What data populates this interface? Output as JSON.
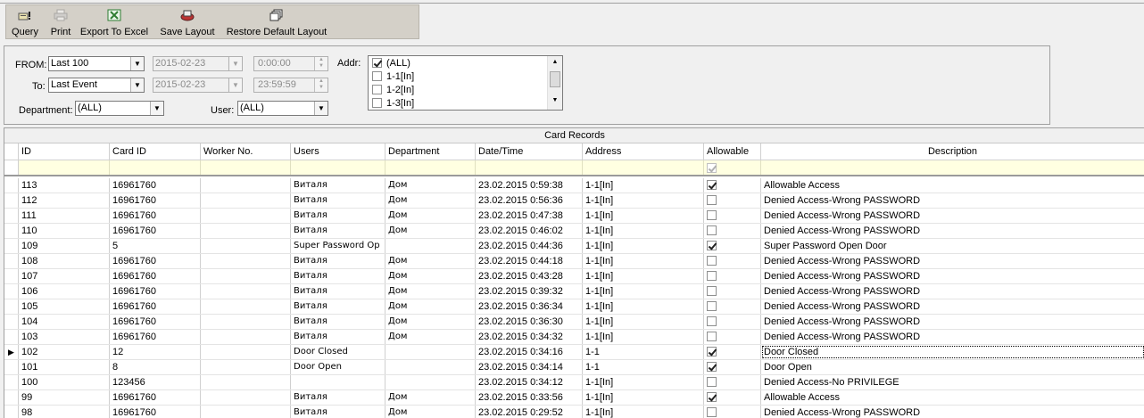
{
  "toolbar": {
    "query": {
      "label": "Query",
      "icon": "query-icon"
    },
    "print": {
      "label": "Print",
      "icon": "print-icon"
    },
    "export": {
      "label": "Export To Excel",
      "icon": "excel-icon"
    },
    "save": {
      "label": "Save Layout",
      "icon": "save-layout-icon"
    },
    "restore": {
      "label": "Restore Default Layout",
      "icon": "restore-layout-icon"
    }
  },
  "filters": {
    "from_label": "FROM:",
    "from_value": "Last 100",
    "from_date": "2015-02-23",
    "from_time": "0:00:00",
    "to_label": "To:",
    "to_value": "Last Event",
    "to_date": "2015-02-23",
    "to_time": "23:59:59",
    "addr_label": "Addr:",
    "addr_items": [
      {
        "label": "(ALL)",
        "checked": true
      },
      {
        "label": "1-1[In]",
        "checked": false
      },
      {
        "label": "1-2[In]",
        "checked": false
      },
      {
        "label": "1-3[In]",
        "checked": false
      }
    ],
    "department_label": "Department:",
    "department_value": "(ALL)",
    "user_label": "User:",
    "user_value": "(ALL)"
  },
  "grid": {
    "title": "Card Records",
    "columns": [
      "ID",
      "Card ID",
      "Worker No.",
      "Users",
      "Department",
      "Date/Time",
      "Address",
      "Allowable",
      "Description"
    ],
    "filter_allowable_checked": true,
    "current_row_index": 11,
    "rows": [
      {
        "id": "113",
        "card": "16961760",
        "worker": "",
        "user": "Виталя",
        "dept": "Дом",
        "dt": "23.02.2015 0:59:38",
        "addr": "1-1[In]",
        "allow": true,
        "desc": "Allowable Access"
      },
      {
        "id": "112",
        "card": "16961760",
        "worker": "",
        "user": "Виталя",
        "dept": "Дом",
        "dt": "23.02.2015 0:56:36",
        "addr": "1-1[In]",
        "allow": false,
        "desc": "Denied Access-Wrong PASSWORD"
      },
      {
        "id": "111",
        "card": "16961760",
        "worker": "",
        "user": "Виталя",
        "dept": "Дом",
        "dt": "23.02.2015 0:47:38",
        "addr": "1-1[In]",
        "allow": false,
        "desc": "Denied Access-Wrong PASSWORD"
      },
      {
        "id": "110",
        "card": "16961760",
        "worker": "",
        "user": "Виталя",
        "dept": "Дом",
        "dt": "23.02.2015 0:46:02",
        "addr": "1-1[In]",
        "allow": false,
        "desc": "Denied Access-Wrong PASSWORD"
      },
      {
        "id": "109",
        "card": "5",
        "worker": "",
        "user": "Super Password Op",
        "dept": "",
        "dt": "23.02.2015 0:44:36",
        "addr": "1-1[In]",
        "allow": true,
        "desc": "Super Password Open Door"
      },
      {
        "id": "108",
        "card": "16961760",
        "worker": "",
        "user": "Виталя",
        "dept": "Дом",
        "dt": "23.02.2015 0:44:18",
        "addr": "1-1[In]",
        "allow": false,
        "desc": "Denied Access-Wrong PASSWORD"
      },
      {
        "id": "107",
        "card": "16961760",
        "worker": "",
        "user": "Виталя",
        "dept": "Дом",
        "dt": "23.02.2015 0:43:28",
        "addr": "1-1[In]",
        "allow": false,
        "desc": "Denied Access-Wrong PASSWORD"
      },
      {
        "id": "106",
        "card": "16961760",
        "worker": "",
        "user": "Виталя",
        "dept": "Дом",
        "dt": "23.02.2015 0:39:32",
        "addr": "1-1[In]",
        "allow": false,
        "desc": "Denied Access-Wrong PASSWORD"
      },
      {
        "id": "105",
        "card": "16961760",
        "worker": "",
        "user": "Виталя",
        "dept": "Дом",
        "dt": "23.02.2015 0:36:34",
        "addr": "1-1[In]",
        "allow": false,
        "desc": "Denied Access-Wrong PASSWORD"
      },
      {
        "id": "104",
        "card": "16961760",
        "worker": "",
        "user": "Виталя",
        "dept": "Дом",
        "dt": "23.02.2015 0:36:30",
        "addr": "1-1[In]",
        "allow": false,
        "desc": "Denied Access-Wrong PASSWORD"
      },
      {
        "id": "103",
        "card": "16961760",
        "worker": "",
        "user": "Виталя",
        "dept": "Дом",
        "dt": "23.02.2015 0:34:32",
        "addr": "1-1[In]",
        "allow": false,
        "desc": "Denied Access-Wrong PASSWORD"
      },
      {
        "id": "102",
        "card": "12",
        "worker": "",
        "user": "Door Closed",
        "dept": "",
        "dt": "23.02.2015 0:34:16",
        "addr": "1-1",
        "allow": true,
        "desc": "Door Closed"
      },
      {
        "id": "101",
        "card": "8",
        "worker": "",
        "user": "Door Open",
        "dept": "",
        "dt": "23.02.2015 0:34:14",
        "addr": "1-1",
        "allow": true,
        "desc": "Door Open"
      },
      {
        "id": "100",
        "card": "123456",
        "worker": "",
        "user": "",
        "dept": "",
        "dt": "23.02.2015 0:34:12",
        "addr": "1-1[In]",
        "allow": false,
        "desc": "Denied Access-No PRIVILEGE"
      },
      {
        "id": "99",
        "card": "16961760",
        "worker": "",
        "user": "Виталя",
        "dept": "Дом",
        "dt": "23.02.2015 0:33:56",
        "addr": "1-1[In]",
        "allow": true,
        "desc": "Allowable Access"
      },
      {
        "id": "98",
        "card": "16961760",
        "worker": "",
        "user": "Виталя",
        "dept": "Дом",
        "dt": "23.02.2015 0:29:52",
        "addr": "1-1[In]",
        "allow": false,
        "desc": "Denied Access-Wrong PASSWORD"
      }
    ]
  }
}
